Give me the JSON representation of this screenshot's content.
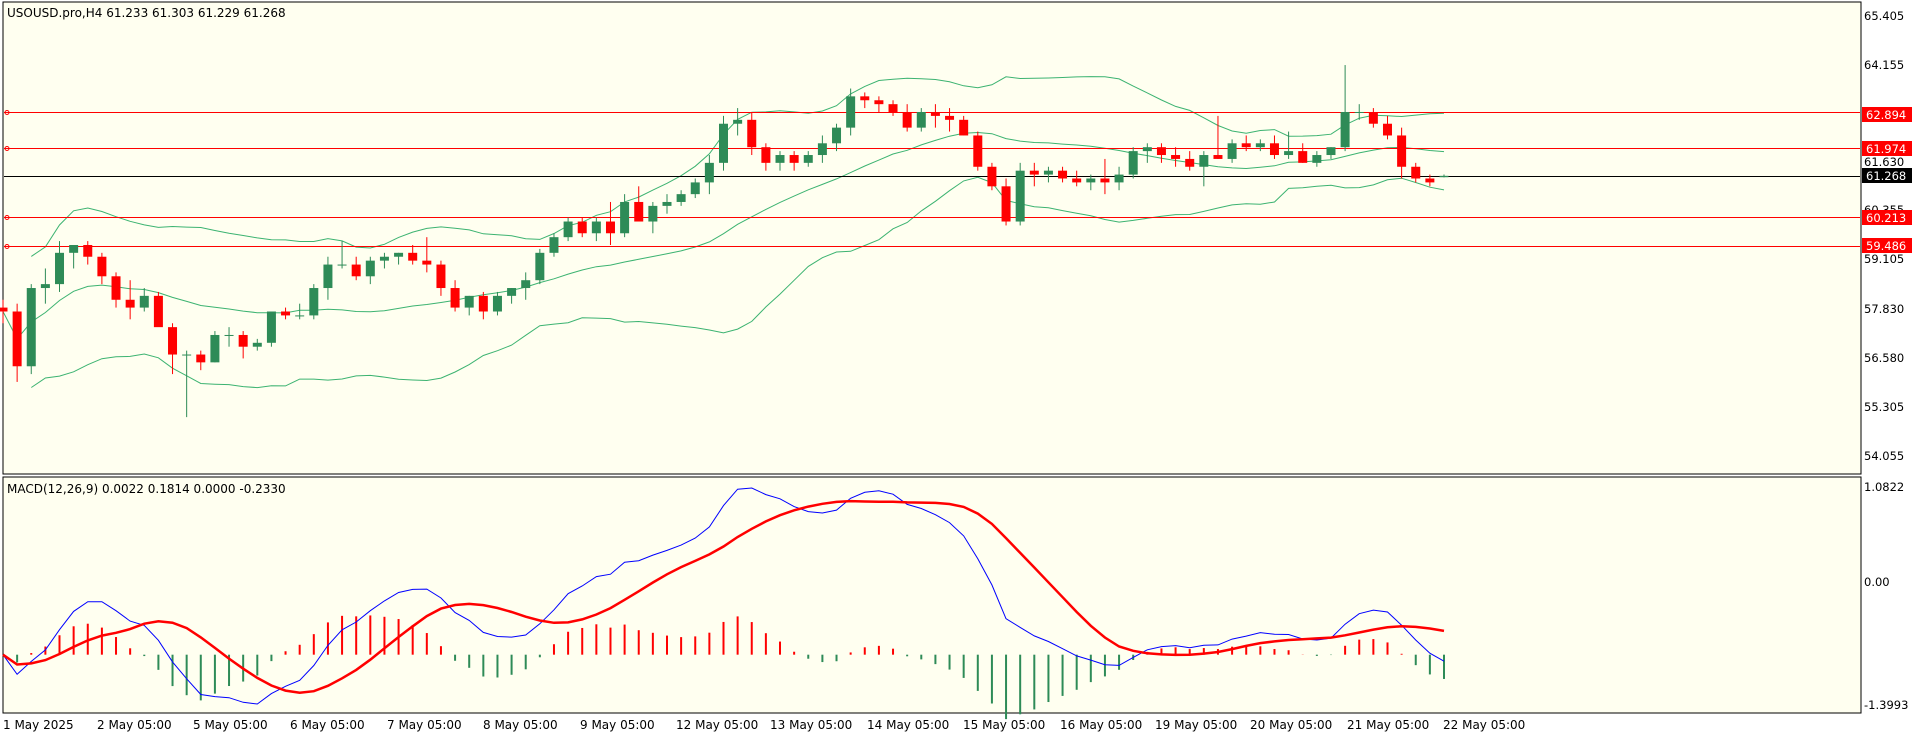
{
  "price_panel": {
    "header": "USOUSD.pro,H4  61.233 61.303 61.229 61.268",
    "price_labels": [
      "65.405",
      "64.155",
      "61.630",
      "60.355",
      "59.105",
      "57.830",
      "56.580",
      "55.305",
      "54.055"
    ],
    "hlines": [
      {
        "value": 62.894,
        "label": "62.894",
        "color": "#ff0000"
      },
      {
        "value": 61.974,
        "label": "61.974",
        "color": "#ff0000"
      },
      {
        "value": 61.268,
        "label": "61.268",
        "color": "#000000"
      },
      {
        "value": 60.213,
        "label": "60.213",
        "color": "#ff0000"
      },
      {
        "value": 59.486,
        "label": "59.486",
        "color": "#ff0000"
      }
    ]
  },
  "macd_panel": {
    "header": "MACD(12,26,9) 0.0022 0.1814 0.0000 -0.2330",
    "scale_labels": [
      "1.0822",
      "0.00",
      "-1.3993"
    ]
  },
  "time_axis": {
    "labels": [
      "1 May 2025",
      "2 May 05:00",
      "5 May 05:00",
      "6 May 05:00",
      "7 May 05:00",
      "8 May 05:00",
      "9 May 05:00",
      "12 May 05:00",
      "13 May 05:00",
      "14 May 05:00",
      "15 May 05:00",
      "16 May 05:00",
      "19 May 05:00",
      "20 May 05:00",
      "21 May 05:00",
      "22 May 05:00"
    ]
  },
  "colors": {
    "background": "#fffff0",
    "bull_candle": "#2e8b57",
    "bear_candle": "#ff0000",
    "bands": "#3cb371",
    "macd_line": "#0000ff",
    "signal_line": "#ff0000"
  },
  "chart_data": [
    {
      "type": "candlestick",
      "symbol": "USOUSD.pro",
      "timeframe": "H4",
      "ylim": [
        54.055,
        65.405
      ],
      "ohlc": [
        [
          57.9,
          58.1,
          57.5,
          57.8
        ],
        [
          57.8,
          58.0,
          56.0,
          56.4
        ],
        [
          56.4,
          58.5,
          56.2,
          58.4
        ],
        [
          58.4,
          58.9,
          58.0,
          58.5
        ],
        [
          58.5,
          59.6,
          58.3,
          59.3
        ],
        [
          59.3,
          59.5,
          58.9,
          59.5
        ],
        [
          59.5,
          59.6,
          59.0,
          59.2
        ],
        [
          59.2,
          59.3,
          58.5,
          58.7
        ],
        [
          58.7,
          58.8,
          57.9,
          58.1
        ],
        [
          58.1,
          58.6,
          57.6,
          57.9
        ],
        [
          57.9,
          58.4,
          57.8,
          58.2
        ],
        [
          58.2,
          58.3,
          57.5,
          57.4
        ],
        [
          57.4,
          57.5,
          56.2,
          56.7
        ],
        [
          56.7,
          56.8,
          55.1,
          56.7
        ],
        [
          56.7,
          56.8,
          56.3,
          56.5
        ],
        [
          56.5,
          57.3,
          56.5,
          57.2
        ],
        [
          57.2,
          57.4,
          56.9,
          57.2
        ],
        [
          57.2,
          57.3,
          56.6,
          56.9
        ],
        [
          56.9,
          57.1,
          56.8,
          57.0
        ],
        [
          57.0,
          57.8,
          56.9,
          57.8
        ],
        [
          57.8,
          57.9,
          57.6,
          57.7
        ],
        [
          57.7,
          58.0,
          57.6,
          57.7
        ],
        [
          57.7,
          58.5,
          57.6,
          58.4
        ],
        [
          58.4,
          59.2,
          58.1,
          59.0
        ],
        [
          59.0,
          59.6,
          58.9,
          59.0
        ],
        [
          59.0,
          59.2,
          58.6,
          58.7
        ],
        [
          58.7,
          59.2,
          58.5,
          59.1
        ],
        [
          59.1,
          59.3,
          58.9,
          59.2
        ],
        [
          59.2,
          59.3,
          59.0,
          59.3
        ],
        [
          59.3,
          59.5,
          59.0,
          59.1
        ],
        [
          59.1,
          59.7,
          58.8,
          59.0
        ],
        [
          59.0,
          59.1,
          58.2,
          58.4
        ],
        [
          58.4,
          58.6,
          57.8,
          57.9
        ],
        [
          57.9,
          58.2,
          57.7,
          58.2
        ],
        [
          58.2,
          58.3,
          57.6,
          57.8
        ],
        [
          57.8,
          58.3,
          57.7,
          58.2
        ],
        [
          58.2,
          58.4,
          58.0,
          58.4
        ],
        [
          58.4,
          58.8,
          58.1,
          58.6
        ],
        [
          58.6,
          59.4,
          58.5,
          59.3
        ],
        [
          59.3,
          59.8,
          59.2,
          59.7
        ],
        [
          59.7,
          60.2,
          59.6,
          60.1
        ],
        [
          60.1,
          60.2,
          59.7,
          59.8
        ],
        [
          59.8,
          60.2,
          59.6,
          60.1
        ],
        [
          60.1,
          60.6,
          59.5,
          59.8
        ],
        [
          59.8,
          60.8,
          59.7,
          60.6
        ],
        [
          60.6,
          61.0,
          60.4,
          60.1
        ],
        [
          60.1,
          60.6,
          59.8,
          60.5
        ],
        [
          60.5,
          60.8,
          60.3,
          60.6
        ],
        [
          60.6,
          60.9,
          60.5,
          60.8
        ],
        [
          60.8,
          61.2,
          60.7,
          61.1
        ],
        [
          61.1,
          61.8,
          60.8,
          61.6
        ],
        [
          61.6,
          62.8,
          61.4,
          62.6
        ],
        [
          62.6,
          63.0,
          62.3,
          62.7
        ],
        [
          62.7,
          62.9,
          61.8,
          62.0
        ],
        [
          62.0,
          62.1,
          61.4,
          61.6
        ],
        [
          61.6,
          61.9,
          61.4,
          61.8
        ],
        [
          61.8,
          61.9,
          61.4,
          61.6
        ],
        [
          61.6,
          61.9,
          61.5,
          61.8
        ],
        [
          61.8,
          62.3,
          61.6,
          62.1
        ],
        [
          62.1,
          62.6,
          61.9,
          62.5
        ],
        [
          62.5,
          63.5,
          62.3,
          63.3
        ],
        [
          63.3,
          63.4,
          63.0,
          63.2
        ],
        [
          63.2,
          63.3,
          62.9,
          63.1
        ],
        [
          63.1,
          63.2,
          62.8,
          62.9
        ],
        [
          62.9,
          63.1,
          62.4,
          62.5
        ],
        [
          62.5,
          63.0,
          62.4,
          62.9
        ],
        [
          62.9,
          63.1,
          62.5,
          62.8
        ],
        [
          62.8,
          63.0,
          62.4,
          62.7
        ],
        [
          62.7,
          62.8,
          62.3,
          62.3
        ],
        [
          62.3,
          62.4,
          61.4,
          61.5
        ],
        [
          61.5,
          61.6,
          60.9,
          61.0
        ],
        [
          61.0,
          61.2,
          60.0,
          60.1
        ],
        [
          60.1,
          61.6,
          60.0,
          61.4
        ],
        [
          61.4,
          61.6,
          61.0,
          61.3
        ],
        [
          61.3,
          61.5,
          61.1,
          61.4
        ],
        [
          61.4,
          61.5,
          61.1,
          61.2
        ],
        [
          61.2,
          61.4,
          61.0,
          61.1
        ],
        [
          61.1,
          61.3,
          60.9,
          61.2
        ],
        [
          61.2,
          61.7,
          60.8,
          61.1
        ],
        [
          61.1,
          61.5,
          60.9,
          61.3
        ],
        [
          61.3,
          62.0,
          61.2,
          61.9
        ],
        [
          61.9,
          62.1,
          61.6,
          62.0
        ],
        [
          62.0,
          62.1,
          61.6,
          61.8
        ],
        [
          61.8,
          62.0,
          61.5,
          61.7
        ],
        [
          61.7,
          61.9,
          61.4,
          61.5
        ],
        [
          61.5,
          61.9,
          61.0,
          61.8
        ],
        [
          61.8,
          62.8,
          61.7,
          61.7
        ],
        [
          61.7,
          62.2,
          61.6,
          62.1
        ],
        [
          62.1,
          62.3,
          61.9,
          62.0
        ],
        [
          62.0,
          62.2,
          61.9,
          62.1
        ],
        [
          62.1,
          62.3,
          61.7,
          61.8
        ],
        [
          61.8,
          62.4,
          61.7,
          61.9
        ],
        [
          61.9,
          62.1,
          61.6,
          61.6
        ],
        [
          61.6,
          61.9,
          61.5,
          61.8
        ],
        [
          61.8,
          62.0,
          61.7,
          62.0
        ],
        [
          62.0,
          64.1,
          61.9,
          62.9
        ],
        [
          62.9,
          63.1,
          62.7,
          62.9
        ],
        [
          62.9,
          63.0,
          62.5,
          62.6
        ],
        [
          62.6,
          62.8,
          62.2,
          62.3
        ],
        [
          62.3,
          62.5,
          61.2,
          61.5
        ],
        [
          61.5,
          61.6,
          61.1,
          61.2
        ],
        [
          61.2,
          61.3,
          61.0,
          61.1
        ],
        [
          61.233,
          61.303,
          61.229,
          61.268
        ]
      ]
    },
    {
      "type": "line",
      "name": "MACD(12,26,9)",
      "ylim": [
        -1.3993,
        1.0822
      ]
    }
  ]
}
